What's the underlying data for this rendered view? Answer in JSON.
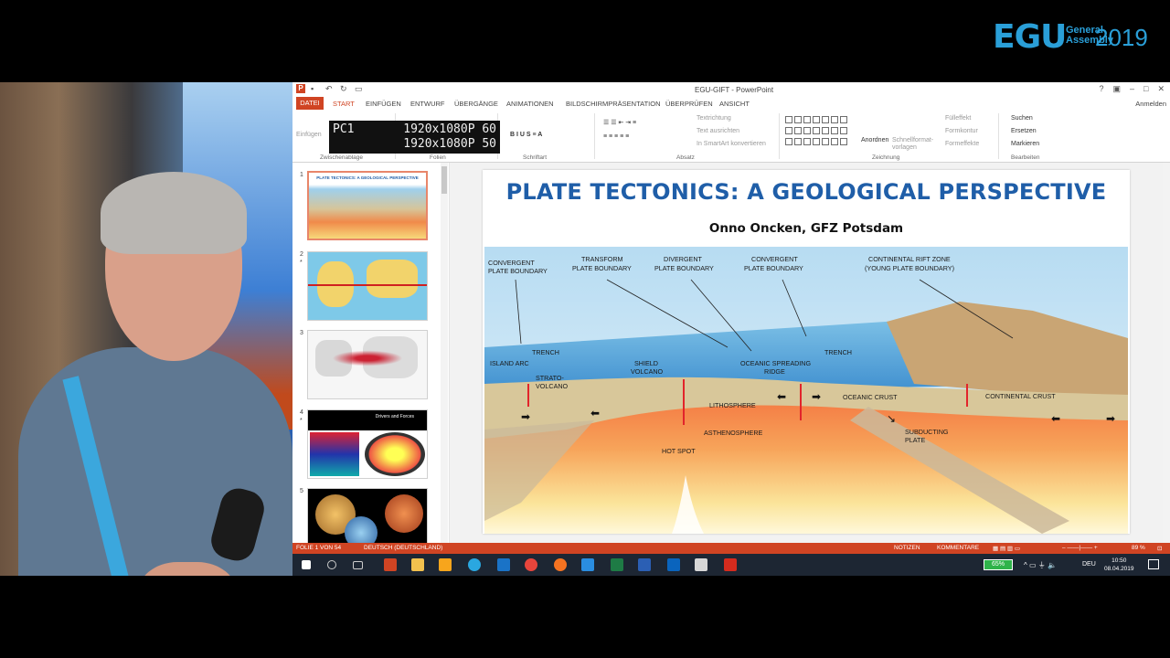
{
  "logo": {
    "mark": "EGU",
    "line1": "General",
    "line2": "Assembly",
    "year": "2019"
  },
  "window": {
    "title": "EGU-GIFT - PowerPoint"
  },
  "tabs": {
    "file": "DATEI",
    "start": "START",
    "insert": "EINFÜGEN",
    "design": "ENTWURF",
    "transitions": "ÜBERGÄNGE",
    "animations": "ANIMATIONEN",
    "slideshow": "BILDSCHIRMPRÄSENTATION",
    "review": "ÜBERPRÜFEN",
    "view": "ANSICHT",
    "signin": "Anmelden"
  },
  "ribbon": {
    "paste": "Einfügen",
    "groups": {
      "clipboard": "Zwischenablage",
      "slides": "Folien",
      "font": "Schriftart",
      "paragraph": "Absatz",
      "drawing": "Zeichnung",
      "editing": "Bearbeiten"
    },
    "text_direction": "Textrichtung",
    "align_text": "Text ausrichten",
    "smartart": "In SmartArt konvertieren",
    "arrange": "Anordnen",
    "quick_styles": "Schnellformat-vorlagen",
    "fill": "Fülleffekt",
    "outline": "Formkontur",
    "effects": "Formeffekte",
    "find": "Suchen",
    "replace": "Ersetzen",
    "select": "Markieren",
    "overlay_label": "PC1",
    "overlay_line1": "1920x1080P 60",
    "overlay_line2": "1920x1080P 50"
  },
  "thumbnails": [
    {
      "num": "1",
      "title": "PLATE TECTONICS: A GEOLOGICAL PERSPECTIVE"
    },
    {
      "num": "2"
    },
    {
      "num": "3"
    },
    {
      "num": "4",
      "title": "Drivers and Forces"
    },
    {
      "num": "5"
    }
  ],
  "slide": {
    "title": "PLATE TECTONICS: A GEOLOGICAL PERSPECTIVE",
    "author": "Onno Oncken, GFZ Potsdam",
    "labels": {
      "convergent1_a": "CONVERGENT",
      "convergent1_b": "PLATE BOUNDARY",
      "transform_a": "TRANSFORM",
      "transform_b": "PLATE BOUNDARY",
      "divergent_a": "DIVERGENT",
      "divergent_b": "PLATE BOUNDARY",
      "convergent2_a": "CONVERGENT",
      "convergent2_b": "PLATE BOUNDARY",
      "rift_a": "CONTINENTAL RIFT ZONE",
      "rift_b": "(YOUNG PLATE BOUNDARY)",
      "trench1": "TRENCH",
      "island_arc": "ISLAND ARC",
      "strato_a": "STRATO-",
      "strato_b": "VOLCANO",
      "shield_a": "SHIELD",
      "shield_b": "VOLCANO",
      "ridge_a": "OCEANIC SPREADING",
      "ridge_b": "RIDGE",
      "trench2": "TRENCH",
      "lithosphere": "LITHOSPHERE",
      "oceanic_crust": "OCEANIC CRUST",
      "continental_crust": "CONTINENTAL CRUST",
      "asthenosphere": "ASTHENOSPHERE",
      "hot_spot": "HOT SPOT",
      "subducting_a": "SUBDUCTING",
      "subducting_b": "PLATE"
    }
  },
  "status": {
    "slide_of": "FOLIE 1 VON 54",
    "language": "DEUTSCH (DEUTSCHLAND)",
    "notes": "NOTIZEN",
    "comments": "KOMMENTARE",
    "zoom": "89 %"
  },
  "taskbar": {
    "battery": "65%",
    "lang": "DEU",
    "time": "10:50",
    "date": "08.04.2019"
  }
}
